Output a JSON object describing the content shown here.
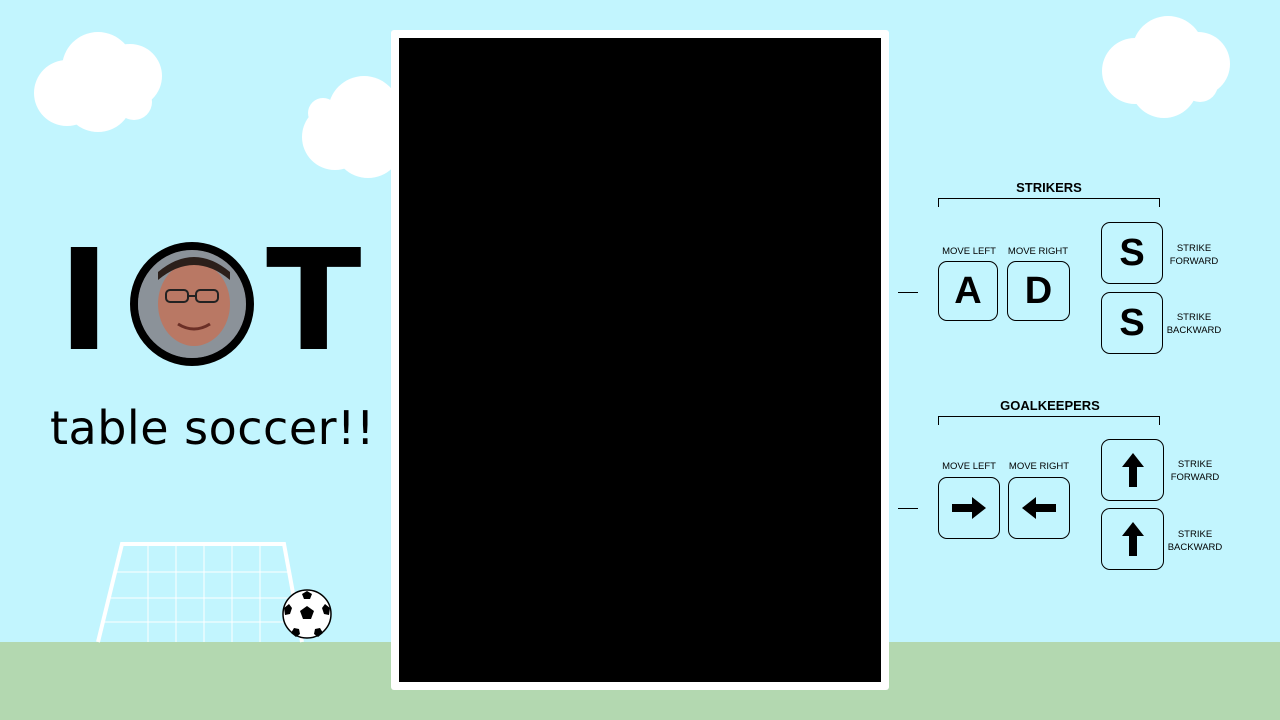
{
  "title": {
    "letters": [
      "I",
      "T"
    ],
    "photo_name": "avatar",
    "subtitle": "table soccer!!"
  },
  "game": {
    "canvas_color": "#000000"
  },
  "controls": {
    "strikers": {
      "heading": "STRIKERS",
      "move_left_label": "MOVE LEFT",
      "move_right_label": "MOVE RIGHT",
      "move_left_key": "A",
      "move_right_key": "D",
      "strike_forward_key": "S",
      "strike_backward_key": "S",
      "strike_forward_label_1": "STRIKE",
      "strike_forward_label_2": "FORWARD",
      "strike_backward_label_1": "STRIKE",
      "strike_backward_label_2": "BACKWARD"
    },
    "goalkeepers": {
      "heading": "GOALKEEPERS",
      "move_left_label": "MOVE LEFT",
      "move_right_label": "MOVE RIGHT",
      "move_left_icon": "right-arrow-icon",
      "move_right_icon": "left-arrow-icon",
      "strike_forward_icon": "up-arrow-icon",
      "strike_backward_icon": "up-arrow-icon",
      "strike_forward_label_1": "STRIKE",
      "strike_forward_label_2": "FORWARD",
      "strike_backward_label_1": "STRIKE",
      "strike_backward_label_2": "BACKWARD"
    }
  },
  "colors": {
    "sky": "#c2f5fe",
    "ground": "#b3d8b0"
  }
}
